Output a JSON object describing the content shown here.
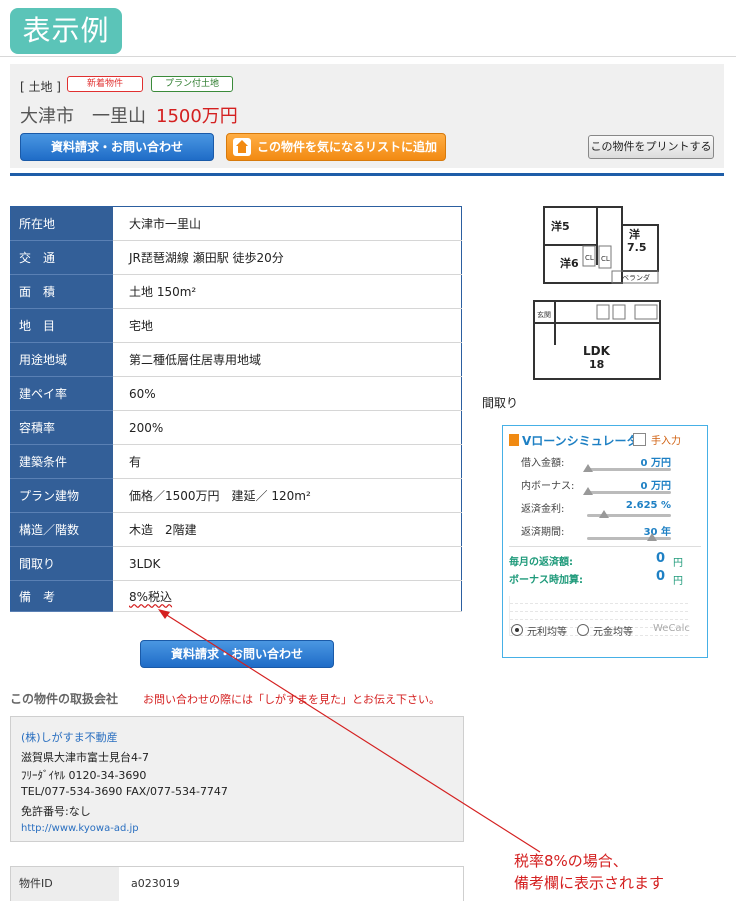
{
  "header": {
    "title": "表示例"
  },
  "listing": {
    "category": "[ 土地 ]",
    "badge_new": "新着物件",
    "badge_plan": "プラン付土地",
    "location": "大津市　一里山",
    "price": "1500万円",
    "btn_inquiry": "資料請求・お問い合わせ",
    "btn_favorite": "この物件を気になるリストに追加",
    "btn_print": "この物件をプリントする"
  },
  "specs": [
    {
      "key": "所在地",
      "value": "大津市一里山"
    },
    {
      "key": "交　通",
      "value": "JR琵琶湖線 瀬田駅 徒歩20分"
    },
    {
      "key": "面　積",
      "value": "土地 150m²"
    },
    {
      "key": "地　目",
      "value": "宅地"
    },
    {
      "key": "用途地域",
      "value": "第二種低層住居専用地域"
    },
    {
      "key": "建ペイ率",
      "value": "60%"
    },
    {
      "key": "容積率",
      "value": "200%"
    },
    {
      "key": "建築条件",
      "value": "有"
    },
    {
      "key": "プラン建物",
      "value": "価格／1500万円　建延／ 120m²"
    },
    {
      "key": "構造／階数",
      "value": "木造　2階建"
    },
    {
      "key": "間取り",
      "value": "3LDK"
    },
    {
      "key": "備　考",
      "value": "8%税込"
    }
  ],
  "floorplan": {
    "room1": "洋5",
    "room2": "洋",
    "room2b": "7.5",
    "room3": "洋6",
    "cl": "CL",
    "balcony": "ベランダ",
    "entrance": "玄関",
    "ldk": "LDK",
    "ldk_size": "18",
    "caption": "間取り"
  },
  "simulator": {
    "title": "Vローンシミュレータ",
    "manual": "手入力",
    "rows": [
      {
        "label": "借入金額:",
        "value": "0 万円",
        "level": 0.0
      },
      {
        "label": "内ボーナス:",
        "value": "0 万円",
        "level": 0.0
      },
      {
        "label": "返済金利:",
        "value": "2.625 %",
        "level": 0.2
      },
      {
        "label": "返済期間:",
        "value": "30 年",
        "level": 0.8
      }
    ],
    "monthly_label": "毎月の返済額:",
    "monthly_value": "0",
    "bonus_label": "ボーナス時加算:",
    "bonus_value": "0",
    "unit": "円",
    "option1": "元利均等",
    "option2": "元金均等",
    "brand": "WeCalc"
  },
  "company": {
    "heading": "この物件の取扱会社",
    "note": "お問い合わせの際には「しがすまを見た」とお伝え下さい。",
    "name": "(株)しがすま不動産",
    "address": "滋賀県大津市富士見台4-7",
    "freedial": "ﾌﾘｰﾀﾞｲﾔﾙ 0120-34-3690",
    "telfax": "TEL/077-534-3690 FAX/077-534-7747",
    "license": "免許番号:なし",
    "url": "http://www.kyowa-ad.jp"
  },
  "property_id": {
    "key": "物件ID",
    "value": "a023019"
  },
  "annotation": {
    "line1": "税率8%の場合、",
    "line2": "備考欄に表示されます"
  },
  "colors": {
    "accent_teal": "#5bc4b8",
    "table_header": "#335f98",
    "price_red": "#d42020",
    "button_blue": "#1f6cc7",
    "button_orange": "#f28a12"
  }
}
